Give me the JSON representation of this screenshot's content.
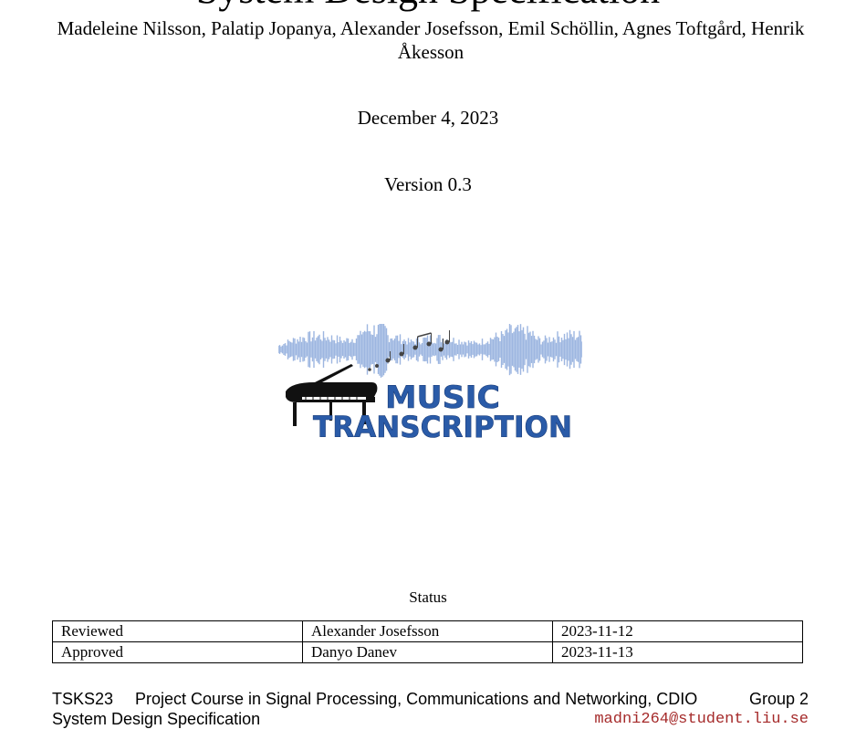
{
  "document": {
    "title": "System Design Specification",
    "authors": "Madeleine Nilsson, Palatip Jopanya, Alexander Josefsson, Emil Schöllin, Agnes Toftgård, Henrik Åkesson",
    "date": "December 4, 2023",
    "version": "Version 0.3"
  },
  "logo": {
    "line1": "MUSIC",
    "line2": "TRANSCRIPTION",
    "colors": {
      "text": "#2a5ba8",
      "waveform": "#9db6e0",
      "piano": "#111111"
    }
  },
  "status": {
    "heading": "Status",
    "rows": [
      {
        "role": "Reviewed",
        "name": "Alexander Josefsson",
        "date": "2023-11-12"
      },
      {
        "role": "Approved",
        "name": "Danyo Danev",
        "date": "2023-11-13"
      }
    ]
  },
  "footer": {
    "course_code": "TSKS23",
    "course_name": "Project Course in Signal Processing, Communications and Networking, CDIO",
    "group": "Group 2",
    "doc_name": "System Design Specification",
    "email": "madni264@student.liu.se",
    "email_color": "#a52a2a"
  }
}
